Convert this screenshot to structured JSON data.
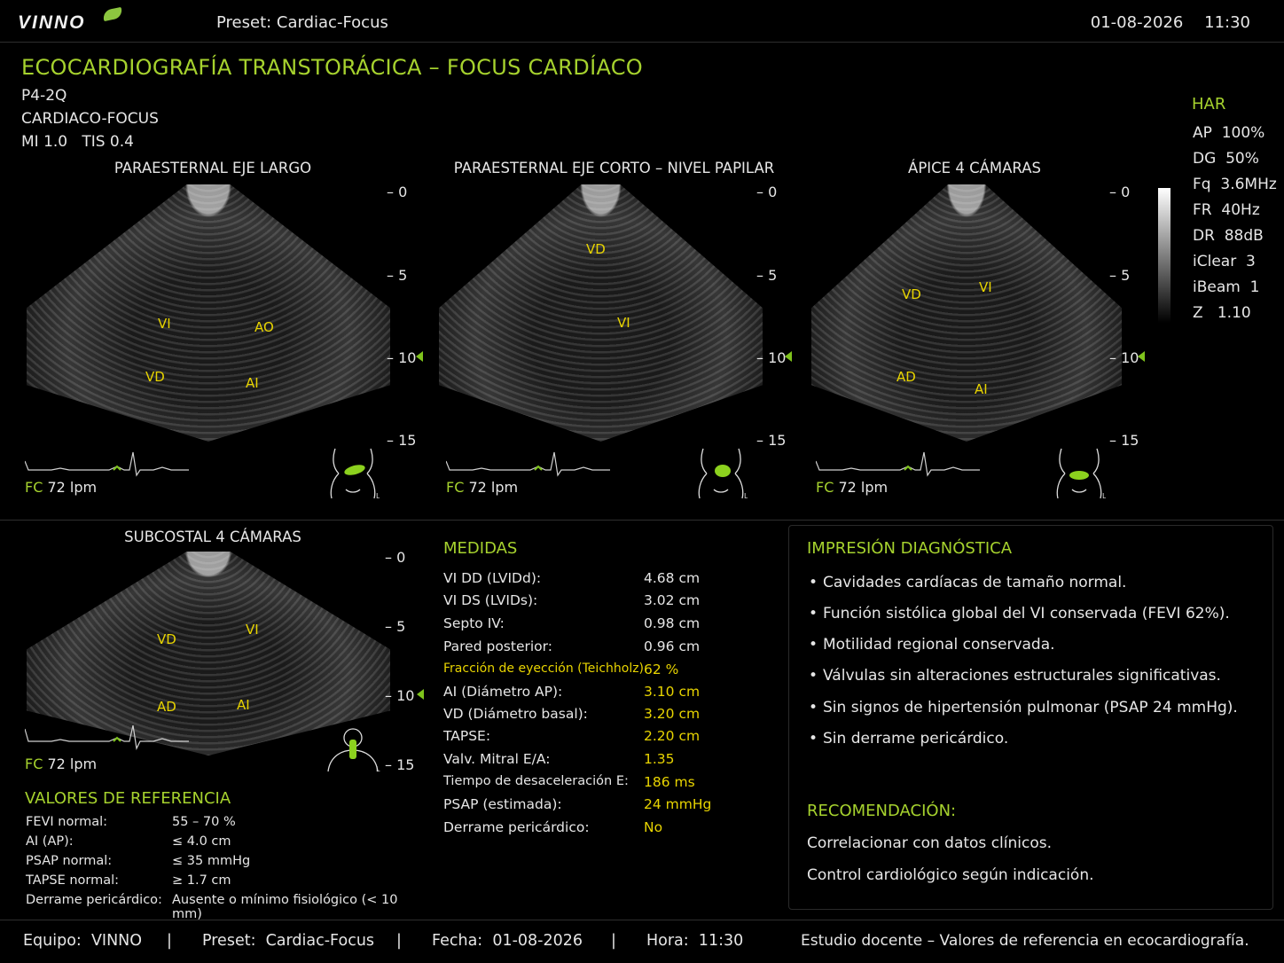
{
  "header": {
    "logo": "VINNO",
    "preset": "Preset:  Cardiac-Focus",
    "date": "01-08-2026",
    "time": "11:30"
  },
  "title": "ECOCARDIOGRAFÍA TRANSTORÁCICA – FOCUS CARDÍACO",
  "probe": "P4-2Q",
  "mode": "CARDIACO-FOCUS",
  "indices": "MI 1.0   TIS 0.4",
  "har": {
    "title": "HAR",
    "items": [
      "AP  100%",
      "DG  50%",
      "Fq  3.6MHz",
      "FR  40Hz",
      "DR  88dB",
      "iClear  3",
      "iBeam  1",
      "Z   1.10"
    ]
  },
  "panels": [
    {
      "title": "PARAESTERNAL EJE LARGO",
      "labels": [
        "VI",
        "AO",
        "VD",
        "AI"
      ],
      "fc_label": "FC",
      "fc_value": "72 lpm",
      "depths": [
        "0",
        "5",
        "10",
        "15"
      ]
    },
    {
      "title": "PARAESTERNAL EJE CORTO – NIVEL PAPILAR",
      "labels": [
        "VD",
        "VI"
      ],
      "fc_label": "FC",
      "fc_value": "72 lpm",
      "depths": [
        "0",
        "5",
        "10",
        "15"
      ]
    },
    {
      "title": "ÁPICE 4 CÁMARAS",
      "labels": [
        "VD",
        "VI",
        "AD",
        "AI"
      ],
      "fc_label": "FC",
      "fc_value": "72 lpm",
      "depths": [
        "0",
        "5",
        "10",
        "15"
      ]
    },
    {
      "title": "SUBCOSTAL 4 CÁMARAS",
      "labels": [
        "VD",
        "VI",
        "AD",
        "AI"
      ],
      "fc_label": "FC",
      "fc_value": "72 lpm",
      "depths": [
        "0",
        "5",
        "10",
        "15"
      ]
    }
  ],
  "measures": {
    "title": "MEDIDAS",
    "rows": [
      {
        "label": "VI DD (LVIDd):",
        "value": "4.68 cm"
      },
      {
        "label": "VI DS (LVIDs):",
        "value": "3.02 cm"
      },
      {
        "label": "Septo IV:",
        "value": "0.98 cm"
      },
      {
        "label": "Pared posterior:",
        "value": "0.96 cm"
      },
      {
        "label": "Fracción de eyección (Teichholz):",
        "value": "62 %"
      },
      {
        "label": "AI (Diámetro AP):",
        "value": "3.10 cm"
      },
      {
        "label": "VD (Diámetro basal):",
        "value": "3.20 cm"
      },
      {
        "label": "TAPSE:",
        "value": "2.20 cm"
      },
      {
        "label": "Valv. Mitral E/A:",
        "value": "1.35"
      },
      {
        "label": "Tiempo de desaceleración E:",
        "value": "186 ms"
      },
      {
        "label": "PSAP (estimada):",
        "value": "24 mmHg"
      },
      {
        "label": "Derrame pericárdico:",
        "value": "No"
      }
    ]
  },
  "reference": {
    "title": "VALORES DE REFERENCIA",
    "rows": [
      {
        "label": "FEVI normal:",
        "value": "55 – 70 %"
      },
      {
        "label": "AI (AP):",
        "value": "≤ 4.0 cm"
      },
      {
        "label": "PSAP normal:",
        "value": "≤ 35 mmHg"
      },
      {
        "label": "TAPSE normal:",
        "value": "≥ 1.7 cm"
      },
      {
        "label": "Derrame pericárdico:",
        "value": "Ausente o mínimo fisiológico (< 10 mm)"
      }
    ]
  },
  "diagnosis": {
    "title": "IMPRESIÓN DIAGNÓSTICA",
    "items": [
      "Cavidades cardíacas de tamaño normal.",
      "Función sistólica global del VI conservada (FEVI 62%).",
      "Motilidad regional conservada.",
      "Válvulas sin alteraciones estructurales significativas.",
      "Sin signos de hipertensión pulmonar (PSAP 24 mmHg).",
      "Sin derrame pericárdico."
    ],
    "bullet": "•"
  },
  "recommendation": {
    "title": "RECOMENDACIÓN:",
    "items": [
      "Correlacionar con datos clínicos.",
      "Control cardiológico según indicación."
    ]
  },
  "footer": {
    "equipo": "Equipo:  VINNO",
    "preset": "Preset:  Cardiac-Focus",
    "fecha": "Fecha:  01-08-2026",
    "hora": "Hora:  11:30",
    "sep": "|",
    "note": "Estudio docente – Valores de referencia en ecocardiografía."
  },
  "colors": {
    "accent": "#a6d22e",
    "values": "#e8d400",
    "background": "#000000"
  }
}
